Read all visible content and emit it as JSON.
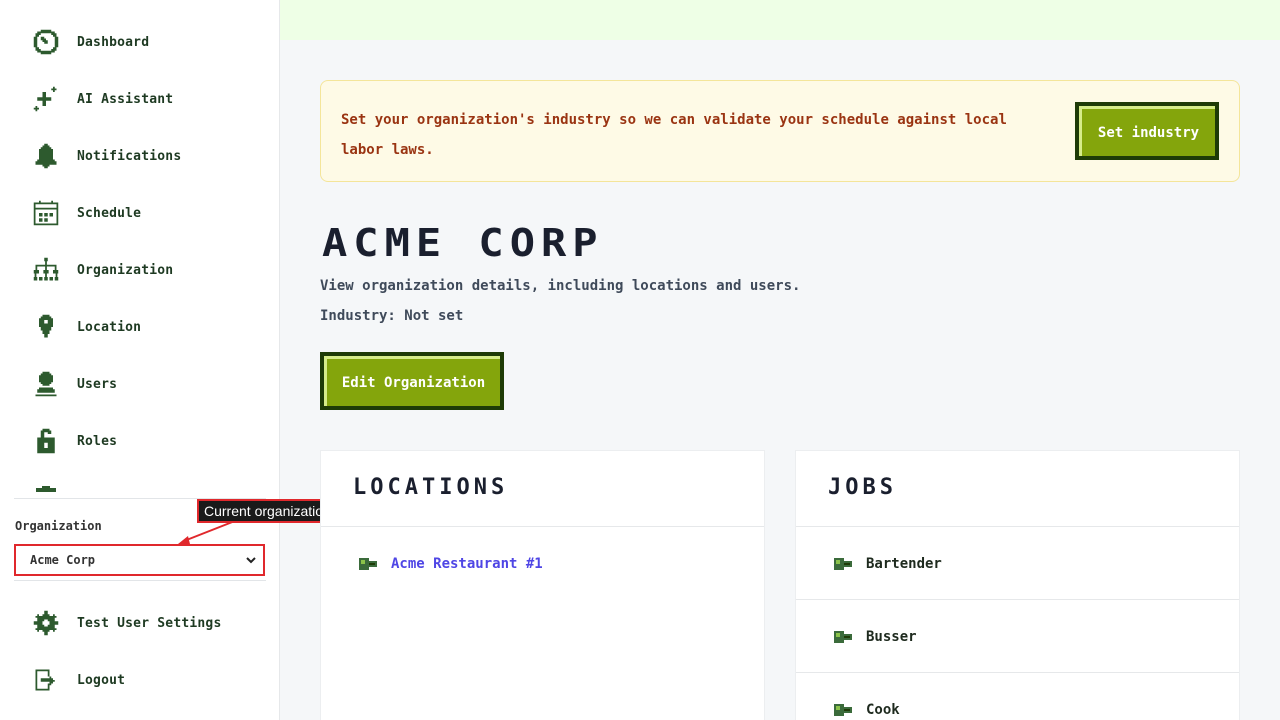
{
  "sidebar": {
    "items": [
      {
        "label": "Dashboard",
        "icon": "dashboard-icon"
      },
      {
        "label": "AI Assistant",
        "icon": "sparkle-icon"
      },
      {
        "label": "Notifications",
        "icon": "bell-icon"
      },
      {
        "label": "Schedule",
        "icon": "calendar-icon"
      },
      {
        "label": "Organization",
        "icon": "org-chart-icon"
      },
      {
        "label": "Location",
        "icon": "map-pin-icon"
      },
      {
        "label": "Users",
        "icon": "user-icon"
      },
      {
        "label": "Roles",
        "icon": "lock-icon"
      }
    ],
    "org_label": "Organization",
    "org_selected": "Acme Corp",
    "bottom_items": [
      {
        "label": "Test User Settings",
        "icon": "gear-icon"
      },
      {
        "label": "Logout",
        "icon": "logout-icon"
      }
    ]
  },
  "annotation": {
    "text": "Current organization",
    "color": "#e0282c"
  },
  "banner": {
    "text": "Set your organization's industry so we can validate your schedule against local labor laws.",
    "button": "Set industry"
  },
  "org": {
    "title": "ACME CORP",
    "description": "View organization details, including locations and users.",
    "industry": "Industry: Not set",
    "edit_button": "Edit Organization"
  },
  "locations": {
    "title": "LOCATIONS",
    "items": [
      "Acme Restaurant #1"
    ]
  },
  "jobs": {
    "title": "JOBS",
    "items": [
      "Bartender",
      "Busser",
      "Cook"
    ]
  },
  "colors": {
    "accent": "#84a50c",
    "accent_dark": "#1e3b07",
    "nav_icon": "#2d5a2e",
    "link": "#4f46e5",
    "banner_text": "#9a3412"
  }
}
